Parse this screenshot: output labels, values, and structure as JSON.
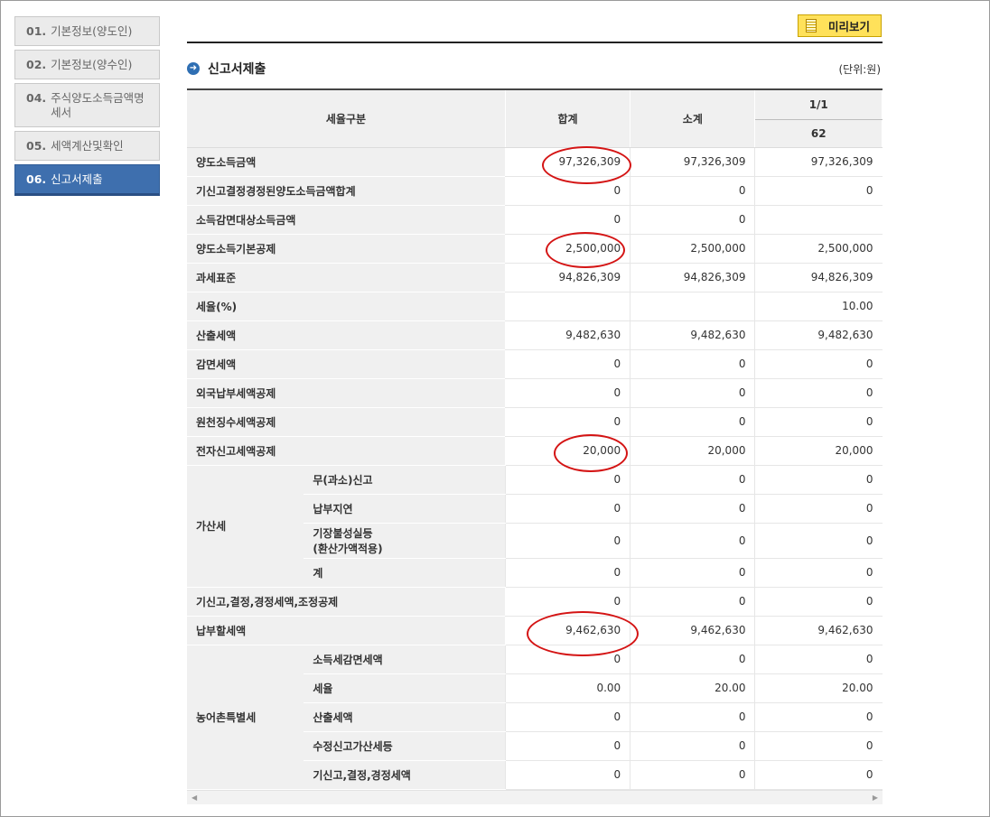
{
  "sidebar": {
    "steps": [
      {
        "num": "01.",
        "label": "기본정보(양도인)"
      },
      {
        "num": "02.",
        "label": "기본정보(양수인)"
      },
      {
        "num": "04.",
        "label": "주식양도소득금액명세서"
      },
      {
        "num": "05.",
        "label": "세액계산및확인"
      },
      {
        "num": "06.",
        "label": "신고서제출"
      }
    ]
  },
  "toolbar": {
    "preview_label": "미리보기"
  },
  "section": {
    "title": "신고서제출",
    "unit": "(단위:원)"
  },
  "table": {
    "headers": {
      "category": "세율구분",
      "total": "합계",
      "subtotal": "소계",
      "page": "1/1",
      "col_code": "62"
    },
    "rows": {
      "r1": {
        "label": "양도소득금액",
        "total": "97,326,309",
        "subtotal": "97,326,309",
        "c62": "97,326,309"
      },
      "r2": {
        "label": "기신고결정경정된양도소득금액합계",
        "total": "0",
        "subtotal": "0",
        "c62": "0"
      },
      "r3": {
        "label": "소득감면대상소득금액",
        "total": "0",
        "subtotal": "0",
        "c62": ""
      },
      "r4": {
        "label": "양도소득기본공제",
        "total": "2,500,000",
        "subtotal": "2,500,000",
        "c62": "2,500,000"
      },
      "r5": {
        "label": "과세표준",
        "total": "94,826,309",
        "subtotal": "94,826,309",
        "c62": "94,826,309"
      },
      "r6": {
        "label": "세율(%)",
        "total": "",
        "subtotal": "",
        "c62": "10.00"
      },
      "r7": {
        "label": "산출세액",
        "total": "9,482,630",
        "subtotal": "9,482,630",
        "c62": "9,482,630"
      },
      "r8": {
        "label": "감면세액",
        "total": "0",
        "subtotal": "0",
        "c62": "0"
      },
      "r9": {
        "label": "외국납부세액공제",
        "total": "0",
        "subtotal": "0",
        "c62": "0"
      },
      "r10": {
        "label": "원천징수세액공제",
        "total": "0",
        "subtotal": "0",
        "c62": "0"
      },
      "r11": {
        "label": "전자신고세액공제",
        "total": "20,000",
        "subtotal": "20,000",
        "c62": "20,000"
      },
      "penalty": {
        "label": "가산세",
        "p1": {
          "label": "무(과소)신고",
          "total": "0",
          "subtotal": "0",
          "c62": "0"
        },
        "p2": {
          "label": "납부지연",
          "total": "0",
          "subtotal": "0",
          "c62": "0"
        },
        "p3": {
          "label": "기장불성실등",
          "label2": "(환산가액적용)",
          "total": "0",
          "subtotal": "0",
          "c62": "0"
        },
        "p4": {
          "label": "계",
          "total": "0",
          "subtotal": "0",
          "c62": "0"
        }
      },
      "r12": {
        "label": "기신고,결정,경정세액,조정공제",
        "total": "0",
        "subtotal": "0",
        "c62": "0"
      },
      "r13": {
        "label": "납부할세액",
        "total": "9,462,630",
        "subtotal": "9,462,630",
        "c62": "9,462,630"
      },
      "rural": {
        "label": "농어촌특별세",
        "s1": {
          "label": "소득세감면세액",
          "total": "0",
          "subtotal": "0",
          "c62": "0"
        },
        "s2": {
          "label": "세율",
          "total": "0.00",
          "subtotal": "20.00",
          "c62": "20.00"
        },
        "s3": {
          "label": "산출세액",
          "total": "0",
          "subtotal": "0",
          "c62": "0"
        },
        "s4": {
          "label": "수정신고가산세등",
          "total": "0",
          "subtotal": "0",
          "c62": "0"
        },
        "s5": {
          "label": "기신고,결정,경정세액",
          "total": "0",
          "subtotal": "0",
          "c62": "0"
        }
      }
    }
  },
  "colors": {
    "active_step": "#3e6fae",
    "preview_button": "#ffe15a",
    "highlight_circle": "#d41414"
  }
}
